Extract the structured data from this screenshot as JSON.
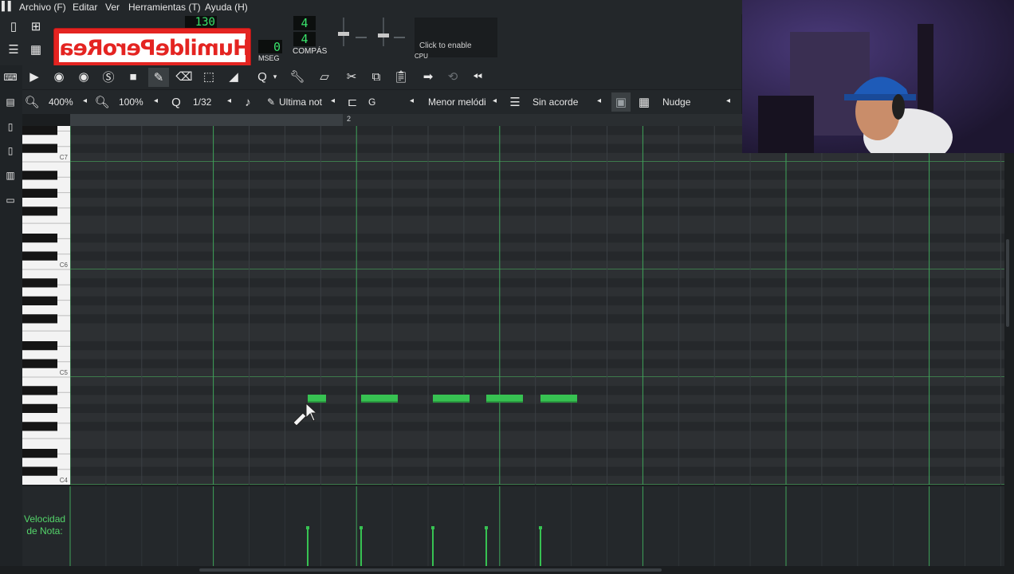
{
  "menu": {
    "items": [
      "Archivo (F)",
      "Editar",
      "Ver",
      "Herramientas (T)",
      "Ayuda (H)"
    ]
  },
  "transport": {
    "tempo": "130",
    "time_sig_top": "4",
    "time_sig_bottom": "4",
    "time_display": "0",
    "time_unit": "MSEG",
    "compas_label": "COMPÁS",
    "cpu_hint": "Click to enable",
    "cpu_label": "CPU"
  },
  "overlay": {
    "text": "HumildePeroReal"
  },
  "piano_roll": {
    "zoom_h": "400%",
    "zoom_v": "100%",
    "quantize": "1/32",
    "note_length": "Ultima not",
    "scale_root": "G",
    "scale_type": "Menor melódi",
    "chord": "Sin acorde",
    "nudge": "Nudge",
    "bar_marker": "2",
    "octaves": [
      "C7",
      "C6",
      "C5",
      "C4"
    ],
    "velocity_label": "Velocidad de Nota:"
  },
  "notes": [
    {
      "start": 386,
      "end": 409
    },
    {
      "start": 453,
      "end": 499
    },
    {
      "start": 543,
      "end": 589
    },
    {
      "start": 610,
      "end": 656
    },
    {
      "start": 678,
      "end": 724
    }
  ],
  "colors": {
    "note": "#37c252",
    "grid_bg": "#2d3033",
    "velocity_text": "#54d56a",
    "overlay_red": "#e42421"
  }
}
